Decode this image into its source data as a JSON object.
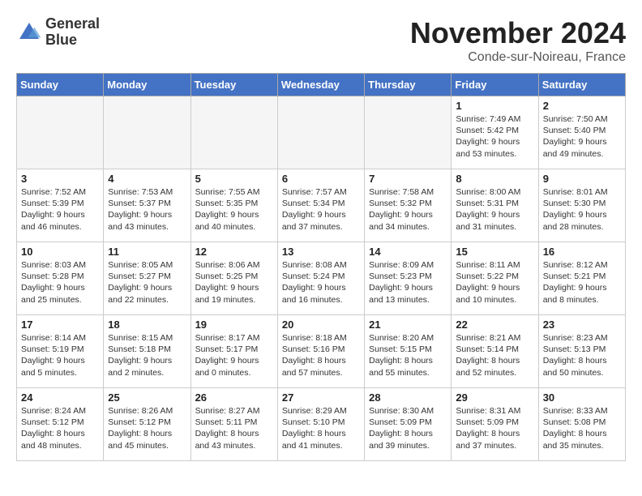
{
  "logo": {
    "line1": "General",
    "line2": "Blue"
  },
  "title": "November 2024",
  "location": "Conde-sur-Noireau, France",
  "header_color": "#4472c4",
  "days_of_week": [
    "Sunday",
    "Monday",
    "Tuesday",
    "Wednesday",
    "Thursday",
    "Friday",
    "Saturday"
  ],
  "weeks": [
    [
      {
        "day": "",
        "info": ""
      },
      {
        "day": "",
        "info": ""
      },
      {
        "day": "",
        "info": ""
      },
      {
        "day": "",
        "info": ""
      },
      {
        "day": "",
        "info": ""
      },
      {
        "day": "1",
        "info": "Sunrise: 7:49 AM\nSunset: 5:42 PM\nDaylight: 9 hours and 53 minutes."
      },
      {
        "day": "2",
        "info": "Sunrise: 7:50 AM\nSunset: 5:40 PM\nDaylight: 9 hours and 49 minutes."
      }
    ],
    [
      {
        "day": "3",
        "info": "Sunrise: 7:52 AM\nSunset: 5:39 PM\nDaylight: 9 hours and 46 minutes."
      },
      {
        "day": "4",
        "info": "Sunrise: 7:53 AM\nSunset: 5:37 PM\nDaylight: 9 hours and 43 minutes."
      },
      {
        "day": "5",
        "info": "Sunrise: 7:55 AM\nSunset: 5:35 PM\nDaylight: 9 hours and 40 minutes."
      },
      {
        "day": "6",
        "info": "Sunrise: 7:57 AM\nSunset: 5:34 PM\nDaylight: 9 hours and 37 minutes."
      },
      {
        "day": "7",
        "info": "Sunrise: 7:58 AM\nSunset: 5:32 PM\nDaylight: 9 hours and 34 minutes."
      },
      {
        "day": "8",
        "info": "Sunrise: 8:00 AM\nSunset: 5:31 PM\nDaylight: 9 hours and 31 minutes."
      },
      {
        "day": "9",
        "info": "Sunrise: 8:01 AM\nSunset: 5:30 PM\nDaylight: 9 hours and 28 minutes."
      }
    ],
    [
      {
        "day": "10",
        "info": "Sunrise: 8:03 AM\nSunset: 5:28 PM\nDaylight: 9 hours and 25 minutes."
      },
      {
        "day": "11",
        "info": "Sunrise: 8:05 AM\nSunset: 5:27 PM\nDaylight: 9 hours and 22 minutes."
      },
      {
        "day": "12",
        "info": "Sunrise: 8:06 AM\nSunset: 5:25 PM\nDaylight: 9 hours and 19 minutes."
      },
      {
        "day": "13",
        "info": "Sunrise: 8:08 AM\nSunset: 5:24 PM\nDaylight: 9 hours and 16 minutes."
      },
      {
        "day": "14",
        "info": "Sunrise: 8:09 AM\nSunset: 5:23 PM\nDaylight: 9 hours and 13 minutes."
      },
      {
        "day": "15",
        "info": "Sunrise: 8:11 AM\nSunset: 5:22 PM\nDaylight: 9 hours and 10 minutes."
      },
      {
        "day": "16",
        "info": "Sunrise: 8:12 AM\nSunset: 5:21 PM\nDaylight: 9 hours and 8 minutes."
      }
    ],
    [
      {
        "day": "17",
        "info": "Sunrise: 8:14 AM\nSunset: 5:19 PM\nDaylight: 9 hours and 5 minutes."
      },
      {
        "day": "18",
        "info": "Sunrise: 8:15 AM\nSunset: 5:18 PM\nDaylight: 9 hours and 2 minutes."
      },
      {
        "day": "19",
        "info": "Sunrise: 8:17 AM\nSunset: 5:17 PM\nDaylight: 9 hours and 0 minutes."
      },
      {
        "day": "20",
        "info": "Sunrise: 8:18 AM\nSunset: 5:16 PM\nDaylight: 8 hours and 57 minutes."
      },
      {
        "day": "21",
        "info": "Sunrise: 8:20 AM\nSunset: 5:15 PM\nDaylight: 8 hours and 55 minutes."
      },
      {
        "day": "22",
        "info": "Sunrise: 8:21 AM\nSunset: 5:14 PM\nDaylight: 8 hours and 52 minutes."
      },
      {
        "day": "23",
        "info": "Sunrise: 8:23 AM\nSunset: 5:13 PM\nDaylight: 8 hours and 50 minutes."
      }
    ],
    [
      {
        "day": "24",
        "info": "Sunrise: 8:24 AM\nSunset: 5:12 PM\nDaylight: 8 hours and 48 minutes."
      },
      {
        "day": "25",
        "info": "Sunrise: 8:26 AM\nSunset: 5:12 PM\nDaylight: 8 hours and 45 minutes."
      },
      {
        "day": "26",
        "info": "Sunrise: 8:27 AM\nSunset: 5:11 PM\nDaylight: 8 hours and 43 minutes."
      },
      {
        "day": "27",
        "info": "Sunrise: 8:29 AM\nSunset: 5:10 PM\nDaylight: 8 hours and 41 minutes."
      },
      {
        "day": "28",
        "info": "Sunrise: 8:30 AM\nSunset: 5:09 PM\nDaylight: 8 hours and 39 minutes."
      },
      {
        "day": "29",
        "info": "Sunrise: 8:31 AM\nSunset: 5:09 PM\nDaylight: 8 hours and 37 minutes."
      },
      {
        "day": "30",
        "info": "Sunrise: 8:33 AM\nSunset: 5:08 PM\nDaylight: 8 hours and 35 minutes."
      }
    ]
  ]
}
